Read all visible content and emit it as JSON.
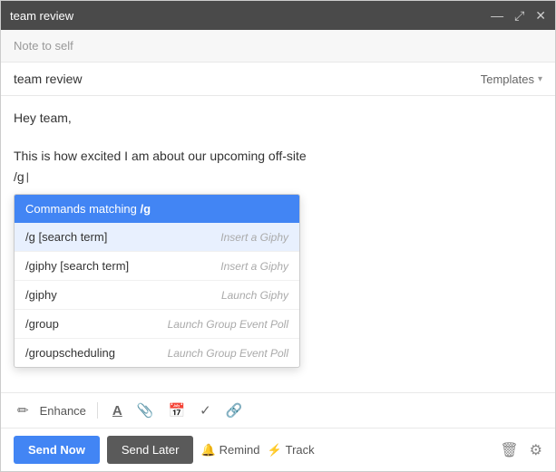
{
  "titlebar": {
    "title": "team review",
    "minimize": "—",
    "expand": "⤢",
    "close": "✕"
  },
  "note_to_self": "Note to self",
  "subject": "team review",
  "templates_label": "Templates",
  "body": {
    "line1": "Hey team,",
    "line2": "",
    "line3": "This is how excited I am about our upcoming off-site",
    "line4": "/g"
  },
  "dropdown": {
    "header_prefix": "Commands matching ",
    "header_term": "/g",
    "items": [
      {
        "cmd": "/g [search term]",
        "desc": "Insert a Giphy",
        "selected": true
      },
      {
        "cmd": "/giphy [search term]",
        "desc": "Insert a Giphy",
        "selected": false
      },
      {
        "cmd": "/giphy",
        "desc": "Launch Giphy",
        "selected": false
      },
      {
        "cmd": "/group",
        "desc": "Launch Group Event Poll",
        "selected": false
      },
      {
        "cmd": "/groupscheduling",
        "desc": "Launch Group Event Poll",
        "selected": false
      }
    ]
  },
  "toolbar": {
    "enhance": "Enhance",
    "icons": [
      "A",
      "📎",
      "📅",
      "✓",
      "🔗"
    ]
  },
  "actions": {
    "send_now": "Send Now",
    "send_later": "Send Later",
    "remind_icon": "🔔",
    "remind_label": "Remind",
    "track_icon": "⚡",
    "track_label": "Track"
  }
}
